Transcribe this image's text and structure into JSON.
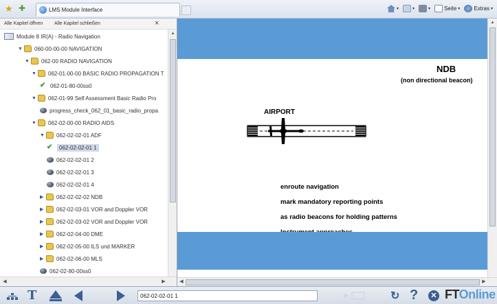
{
  "browser": {
    "tab_title": "LMS Module Interface",
    "commands": {
      "page": "Seite",
      "tools": "Extras"
    }
  },
  "toc": {
    "open_all": "Alle Kapitel öffnen",
    "close_all": "Alle Kapitel schließen",
    "close_glyph": "×",
    "items": [
      {
        "label": "Module 8 IR(A) - Radio Navigation",
        "icon": "book-icon",
        "expand": ""
      },
      {
        "label": "060-00-00-00 NAVIGATION",
        "icon": "folder-icon",
        "expand": "▼"
      },
      {
        "label": "062-00 RADIO NAVIGATION",
        "icon": "folder-icon",
        "expand": "▼"
      },
      {
        "label": "062-01-00-00 BASIC RADIO PROPAGATION T",
        "icon": "folder-icon",
        "expand": "▼"
      },
      {
        "label": "062-01-80-00ss0",
        "icon": "check-icon",
        "expand": ""
      },
      {
        "label": "062-01-99 Self Assessment Basic Radio Pro",
        "icon": "folder-icon",
        "expand": "▼"
      },
      {
        "label": "progress_check_062_01_basic_radio_propa",
        "icon": "ball-icon",
        "expand": ""
      },
      {
        "label": "062-02-00-00 RADIO AIDS",
        "icon": "folder-icon",
        "expand": "▼"
      },
      {
        "label": "062-02-02-01 ADF",
        "icon": "folder-icon",
        "expand": "▼"
      },
      {
        "label": "062-02-02-01 1",
        "icon": "check-icon",
        "expand": "",
        "selected": true
      },
      {
        "label": "062-02-02-01 2",
        "icon": "ball-icon",
        "expand": ""
      },
      {
        "label": "062-02-02-01 3",
        "icon": "ball-icon",
        "expand": ""
      },
      {
        "label": "062-02-02-01 4",
        "icon": "ball-icon",
        "expand": ""
      },
      {
        "label": "062-02-02-02 NDB",
        "icon": "folder-icon",
        "expand": "▶"
      },
      {
        "label": "062-02-03-01 VOR and Doppler VOR",
        "icon": "folder-icon",
        "expand": "▶"
      },
      {
        "label": "062-02-03-02 VOR and Doppler VOR",
        "icon": "folder-icon",
        "expand": "▶"
      },
      {
        "label": "062-02-04-00 DME",
        "icon": "folder-icon",
        "expand": "▶"
      },
      {
        "label": "062-02-05-00 ILS und MARKER",
        "icon": "folder-icon",
        "expand": "▶"
      },
      {
        "label": "062-02-06-00 MLS",
        "icon": "folder-icon",
        "expand": "▶"
      },
      {
        "label": "062-02-80-00ss0",
        "icon": "ball-icon",
        "expand": ""
      }
    ]
  },
  "slide": {
    "title": "NDB",
    "subtitle": "(non directional beacon)",
    "airport_label": "AIRPORT",
    "bullets": [
      "enroute navigation",
      "mark mandatory reporting points",
      "as radio beacons for holding patterns",
      "Instrument approaches"
    ],
    "band_color": "#5b9bd5"
  },
  "bottom": {
    "page_field_value": "062-02-02-01 1",
    "logo_ft": "FT",
    "logo_online": "Online"
  }
}
